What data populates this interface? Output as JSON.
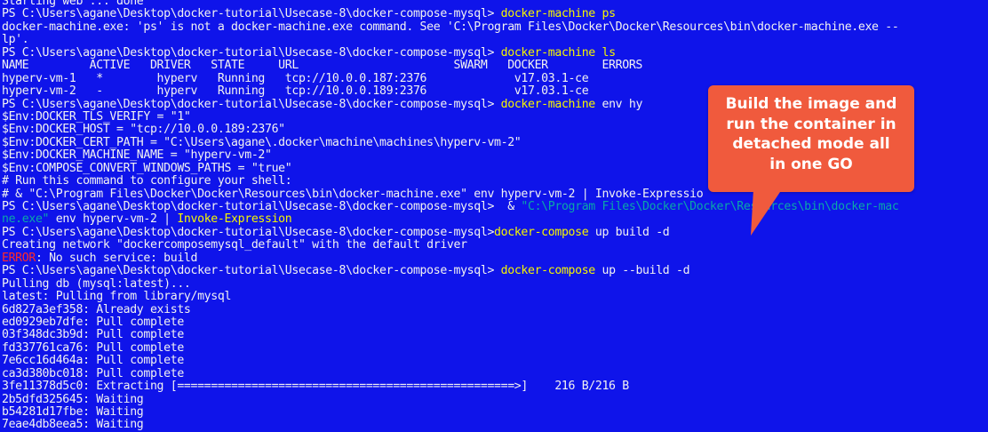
{
  "terminal": {
    "lines": [
      [
        {
          "text": "Starting web ... done",
          "style": "norm"
        }
      ],
      [
        {
          "text": "PS C:\\Users\\agane\\Desktop\\docker-tutorial\\Usecase-8\\docker-compose-mysql> ",
          "style": "norm"
        },
        {
          "text": "docker-machine ps",
          "style": "cmd"
        }
      ],
      [
        {
          "text": "docker-machine.exe: 'ps' is not a docker-machine.exe command. See 'C:\\Program Files\\Docker\\Docker\\Resources\\bin\\docker-machine.exe --",
          "style": "norm"
        }
      ],
      [
        {
          "text": "lp'.",
          "style": "norm"
        }
      ],
      [
        {
          "text": "PS C:\\Users\\agane\\Desktop\\docker-tutorial\\Usecase-8\\docker-compose-mysql> ",
          "style": "norm"
        },
        {
          "text": "docker-machine ls",
          "style": "cmd"
        }
      ],
      [
        {
          "text": "NAME         ACTIVE   DRIVER   STATE     URL                       SWARM   DOCKER        ERRORS",
          "style": "norm"
        }
      ],
      [
        {
          "text": "hyperv-vm-1   *        hyperv   Running   tcp://10.0.0.187:2376             v17.03.1-ce",
          "style": "norm"
        }
      ],
      [
        {
          "text": "hyperv-vm-2   -        hyperv   Running   tcp://10.0.0.189:2376             v17.03.1-ce",
          "style": "norm"
        }
      ],
      [
        {
          "text": "PS C:\\Users\\agane\\Desktop\\docker-tutorial\\Usecase-8\\docker-compose-mysql> ",
          "style": "norm"
        },
        {
          "text": "docker-machine",
          "style": "cmd"
        },
        {
          "text": " env hy",
          "style": "norm"
        }
      ],
      [
        {
          "text": "$Env:DOCKER_TLS_VERIFY = \"1\"",
          "style": "norm"
        }
      ],
      [
        {
          "text": "$Env:DOCKER_HOST = \"tcp://10.0.0.189:2376\"",
          "style": "norm"
        }
      ],
      [
        {
          "text": "$Env:DOCKER_CERT_PATH = \"C:\\Users\\agane\\.docker\\machine\\machines\\hyperv-vm-2\"",
          "style": "norm"
        }
      ],
      [
        {
          "text": "$Env:DOCKER_MACHINE_NAME = \"hyperv-vm-2\"",
          "style": "norm"
        }
      ],
      [
        {
          "text": "$Env:COMPOSE_CONVERT_WINDOWS_PATHS = \"true\"",
          "style": "norm"
        }
      ],
      [
        {
          "text": "# Run this command to configure your shell:",
          "style": "norm"
        }
      ],
      [
        {
          "text": "# & \"C:\\Program Files\\Docker\\Docker\\Resources\\bin\\docker-machine.exe\" env hyperv-vm-2 | Invoke-Expressio",
          "style": "norm"
        }
      ],
      [
        {
          "text": "PS C:\\Users\\agane\\Desktop\\docker-tutorial\\Usecase-8\\docker-compose-mysql>  & ",
          "style": "norm"
        },
        {
          "text": "\"C:\\Program Files\\Docker\\Docker\\Resources\\bin\\docker-mac",
          "style": "str"
        }
      ],
      [
        {
          "text": "ne.exe\"",
          "style": "str"
        },
        {
          "text": " env hyperv-vm-2 | ",
          "style": "norm"
        },
        {
          "text": "Invoke-Expression",
          "style": "cmd"
        }
      ],
      [
        {
          "text": "PS C:\\Users\\agane\\Desktop\\docker-tutorial\\Usecase-8\\docker-compose-mysql>",
          "style": "norm"
        },
        {
          "text": "docker-compose",
          "style": "cmd"
        },
        {
          "text": " up build -d",
          "style": "norm"
        }
      ],
      [
        {
          "text": "Creating network \"dockercomposemysql_default\" with the default driver",
          "style": "norm"
        }
      ],
      [
        {
          "text": "ERROR",
          "style": "err"
        },
        {
          "text": ": No such service: build",
          "style": "norm"
        }
      ],
      [
        {
          "text": "PS C:\\Users\\agane\\Desktop\\docker-tutorial\\Usecase-8\\docker-compose-mysql> ",
          "style": "norm"
        },
        {
          "text": "docker-compose",
          "style": "cmd"
        },
        {
          "text": " up --build -d",
          "style": "norm"
        }
      ],
      [
        {
          "text": "Pulling db (mysql:latest)...",
          "style": "norm"
        }
      ],
      [
        {
          "text": "latest: Pulling from library/mysql",
          "style": "norm"
        }
      ],
      [
        {
          "text": "6d827a3ef358: Already exists",
          "style": "norm"
        }
      ],
      [
        {
          "text": "ed0929eb7dfe: Pull complete",
          "style": "norm"
        }
      ],
      [
        {
          "text": "03f348dc3b9d: Pull complete",
          "style": "norm"
        }
      ],
      [
        {
          "text": "fd337761ca76: Pull complete",
          "style": "norm"
        }
      ],
      [
        {
          "text": "7e6cc16d464a: Pull complete",
          "style": "norm"
        }
      ],
      [
        {
          "text": "ca3d380bc018: Pull complete",
          "style": "norm"
        }
      ],
      [
        {
          "text": "3fe11378d5c0: Extracting [==================================================>]    216 B/216 B",
          "style": "norm"
        }
      ],
      [
        {
          "text": "2b5dfd325645: Waiting",
          "style": "norm"
        }
      ],
      [
        {
          "text": "b54281d17fbe: Waiting",
          "style": "norm"
        }
      ],
      [
        {
          "text": "7eae4db8eea5: Waiting",
          "style": "norm"
        }
      ]
    ]
  },
  "callout": {
    "text": "Build the image and\nrun the container in\ndetached mode all\nin one GO"
  },
  "colors": {
    "background": "#0f14ea",
    "text": "#f2f2f2",
    "command": "#f5f500",
    "error": "#ff2a2a",
    "string": "#0aa8a8",
    "callout": "#f05a3d"
  }
}
